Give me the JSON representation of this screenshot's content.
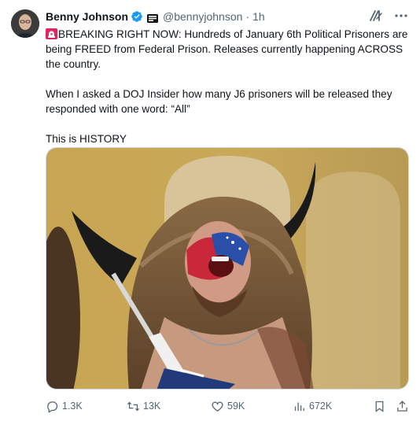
{
  "author": {
    "name": "Benny Johnson",
    "handle": "@bennyjohnson",
    "separator": "·",
    "time": "1h",
    "verified": true,
    "verified_color": "#1d9bf0"
  },
  "post": {
    "paragraph1": "BREAKING RIGHT NOW: Hundreds of January 6th Political Prisoners are being FREED from Federal Prison. Releases currently happening ACROSS the country.",
    "paragraph2": "When I asked a DOJ Insider how many J6 prisoners will be released they responded with one word: “All”",
    "paragraph3": "This is HISTORY",
    "leading_icon": "siren-icon"
  },
  "media": {
    "kind": "photo",
    "icon": "photo"
  },
  "actions": {
    "replies": "1.3K",
    "reposts": "13K",
    "likes": "59K",
    "views": "672K"
  },
  "colors": {
    "text": "#0f1419",
    "muted": "#536471",
    "accent": "#1d9bf0"
  }
}
